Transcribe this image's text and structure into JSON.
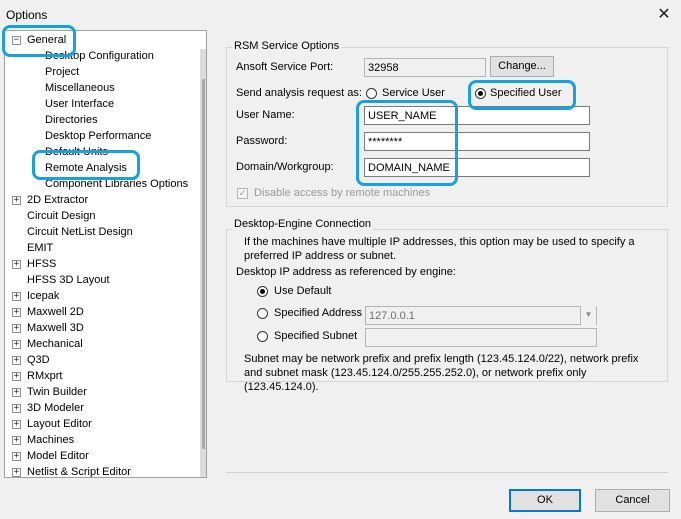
{
  "window": {
    "title": "Options",
    "close_glyph": "✕"
  },
  "tree": {
    "items": [
      {
        "label": "General",
        "expander": "−"
      },
      {
        "label": "Desktop Configuration"
      },
      {
        "label": "Project"
      },
      {
        "label": "Miscellaneous"
      },
      {
        "label": "User Interface"
      },
      {
        "label": "Directories"
      },
      {
        "label": "Desktop Performance"
      },
      {
        "label": "Default Units"
      },
      {
        "label": "Remote Analysis"
      },
      {
        "label": "Component Libraries Options"
      },
      {
        "label": "2D Extractor",
        "expander": "+"
      },
      {
        "label": "Circuit Design"
      },
      {
        "label": "Circuit NetList Design"
      },
      {
        "label": "EMIT"
      },
      {
        "label": "HFSS",
        "expander": "+"
      },
      {
        "label": "HFSS 3D Layout"
      },
      {
        "label": "Icepak",
        "expander": "+"
      },
      {
        "label": "Maxwell 2D",
        "expander": "+"
      },
      {
        "label": "Maxwell 3D",
        "expander": "+"
      },
      {
        "label": "Mechanical",
        "expander": "+"
      },
      {
        "label": "Q3D",
        "expander": "+"
      },
      {
        "label": "RMxprt",
        "expander": "+"
      },
      {
        "label": "Twin Builder",
        "expander": "+"
      },
      {
        "label": "3D Modeler",
        "expander": "+"
      },
      {
        "label": "Layout Editor",
        "expander": "+"
      },
      {
        "label": "Machines",
        "expander": "+"
      },
      {
        "label": "Model Editor",
        "expander": "+"
      },
      {
        "label": "Netlist & Script Editor",
        "expander": "+"
      }
    ]
  },
  "rsm": {
    "group_title": "RSM Service Options",
    "port_label": "Ansoft Service Port:",
    "port_value": "32958",
    "change_button": "Change...",
    "send_label": "Send analysis request as:",
    "service_user": "Service User",
    "specified_user": "Specified User",
    "selected": "Specified User",
    "username_label": "User Name:",
    "username_value": "USER_NAME",
    "password_label": "Password:",
    "password_value": "********",
    "domain_label": "Domain/Workgroup:",
    "domain_value": "DOMAIN_NAME",
    "disable_access": "Disable access by remote machines",
    "disable_access_checked": true
  },
  "engine": {
    "group_title": "Desktop-Engine Connection",
    "info": "If the machines have multiple IP addresses, this option may be used to specify a preferred IP address or subnet.",
    "ip_label": "Desktop IP address as referenced by engine:",
    "use_default": "Use Default",
    "specified_address": "Specified Address",
    "specified_address_value": "127.0.0.1",
    "specified_subnet": "Specified Subnet",
    "selected": "Use Default",
    "subnet_note": "Subnet may be network prefix and prefix length (123.45.124.0/22), network prefix and subnet mask (123.45.124.0/255.255.252.0), or network prefix only (123.45.124.0)."
  },
  "footer": {
    "ok": "OK",
    "cancel": "Cancel"
  },
  "colors": {
    "highlight": "#19a0e0",
    "default_button_border": "#0078d7"
  }
}
